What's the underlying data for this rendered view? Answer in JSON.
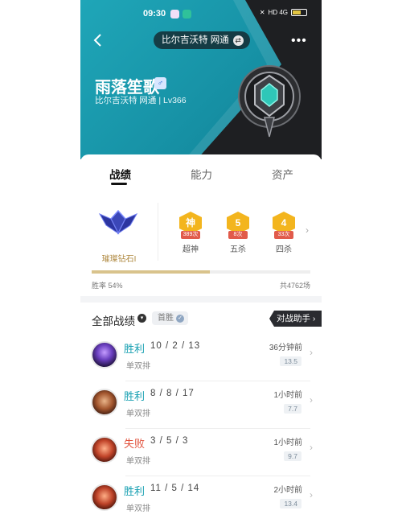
{
  "status_bar": {
    "time": "09:30",
    "network": "HD 4G",
    "battery": "40"
  },
  "header": {
    "server_pill": "比尔吉沃特 网通",
    "player_name": "雨落笙歌",
    "gender_icon": "male-icon",
    "player_sub": "比尔吉沃特 网通 | Lv366"
  },
  "tabs": [
    {
      "label": "战绩",
      "active": true
    },
    {
      "label": "能力",
      "active": false
    },
    {
      "label": "资产",
      "active": false
    }
  ],
  "rank": {
    "tier": "璀璨钻石I",
    "honors": [
      {
        "badge": "神",
        "count": "389次",
        "label": "超神"
      },
      {
        "badge": "5",
        "count": "8次",
        "label": "五杀"
      },
      {
        "badge": "4",
        "count": "33次",
        "label": "四杀"
      }
    ],
    "win_rate_label": "胜率  54%",
    "win_rate_fraction": 0.54,
    "total_games": "共4762场"
  },
  "list": {
    "title": "全部战绩",
    "filter_chip": "首胜",
    "assistant_button": "对战助手"
  },
  "matches": [
    {
      "result": "胜利",
      "kda": "10 / 2 / 13",
      "mode": "单双排",
      "time": "36分钟前",
      "score": "13.5"
    },
    {
      "result": "胜利",
      "kda": "8 / 8 / 17",
      "mode": "单双排",
      "time": "1小时前",
      "score": "7.7"
    },
    {
      "result": "失败",
      "kda": "3 / 5 / 3",
      "mode": "单双排",
      "time": "1小时前",
      "score": "9.7"
    },
    {
      "result": "胜利",
      "kda": "11 / 5 / 14",
      "mode": "单双排",
      "time": "2小时前",
      "score": "13.4"
    }
  ],
  "colors": {
    "accent": "#18a0b2",
    "loss": "#e2543f",
    "honor": "#f3b51e",
    "rank_gold": "#b08a42"
  }
}
